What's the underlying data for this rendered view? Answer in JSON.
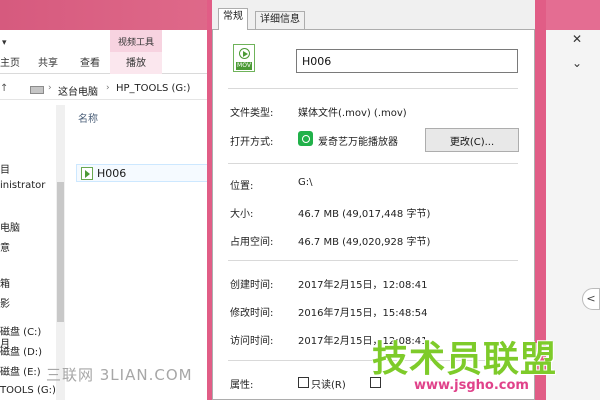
{
  "explorer": {
    "collapse_glyph": "▾",
    "ribbon": {
      "context_title": "视频工具",
      "tabs": [
        "主页",
        "共享",
        "查看",
        "播放"
      ]
    },
    "address": {
      "back_glyph": "↑",
      "separator": "›",
      "crumbs": [
        "这台电脑",
        "HP_TOOLS (G:)"
      ]
    },
    "nav_items": [
      "目",
      "inistrator",
      "电脑",
      "意",
      "箱",
      "影",
      "月",
      "磁盘 (C:)",
      "磁盘 (D:)",
      "磁盘 (E:)",
      "TOOLS (G:)"
    ],
    "column_header": "名称",
    "files": [
      {
        "name": "H006",
        "icon": "video-file-icon"
      }
    ],
    "watermark": "三联网 3LIAN.COM"
  },
  "dialog": {
    "tabs": [
      "常规",
      "详细信息"
    ],
    "file_name": "H006",
    "file_icon_tag": "MOV",
    "file_type": {
      "label": "文件类型:",
      "value": "媒体文件(.mov) (.mov)"
    },
    "open_with": {
      "label": "打开方式:",
      "app": "爱奇艺万能播放器",
      "change_button": "更改(C)..."
    },
    "location": {
      "label": "位置:",
      "value": "G:\\"
    },
    "size": {
      "label": "大小:",
      "value": "46.7 MB (49,017,448 字节)"
    },
    "size_on_disk": {
      "label": "占用空间:",
      "value": "46.7 MB (49,020,928 字节)"
    },
    "created": {
      "label": "创建时间:",
      "value": "2017年2月15日，12:08:41"
    },
    "modified": {
      "label": "修改时间:",
      "value": "2016年7月15日，15:48:54"
    },
    "accessed": {
      "label": "访问时间:",
      "value": "2017年2月15日，12:08:41"
    },
    "attributes": {
      "label": "属性:",
      "readonly": "只读(R)",
      "readonly_checked": false
    }
  },
  "window_controls": {
    "close": "✕",
    "expand": "⌄"
  },
  "side_arrow": "<",
  "watermark_logo": {
    "text": "技术员联盟",
    "url": "www.jsgho.com"
  },
  "colors": {
    "accent_pink": "#e15d86",
    "logo_green": "#7ecb2a"
  }
}
